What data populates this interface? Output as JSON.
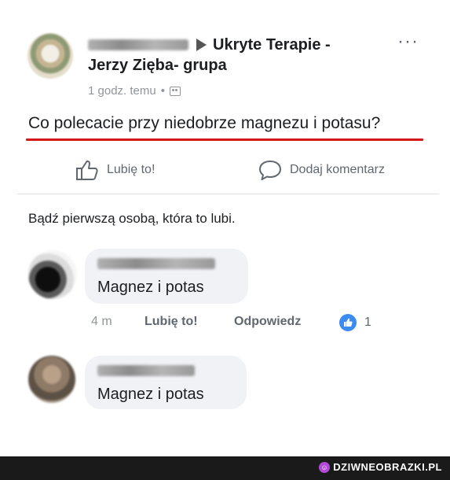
{
  "post": {
    "group_line1": "Ukryte Terapie -",
    "group_line2": "Jerzy Zięba- grupa",
    "time": "1 godz. temu",
    "separator": "•",
    "more": "···",
    "text": "Co polecacie przy niedobrze magnezu i potasu?"
  },
  "actions": {
    "like_label": "Lubię to!",
    "comment_label": "Dodaj komentarz"
  },
  "first_like_text": "Bądź pierwszą osobą, która to lubi.",
  "comments": [
    {
      "text": "Magnez i potas",
      "time": "4 m",
      "like_label": "Lubię to!",
      "reply_label": "Odpowiedz",
      "reaction_count": "1"
    },
    {
      "text": "Magnez i potas"
    }
  ],
  "watermark": "DZIWNEOBRAZKI.PL",
  "colors": {
    "highlight_underline": "#d4171a",
    "like_badge": "#3b8bf2",
    "bubble_bg": "#f1f2f6"
  },
  "icons": [
    "arrow-right-icon",
    "more-icon",
    "group-icon",
    "thumbs-up-icon",
    "comment-icon",
    "like-badge-icon"
  ]
}
